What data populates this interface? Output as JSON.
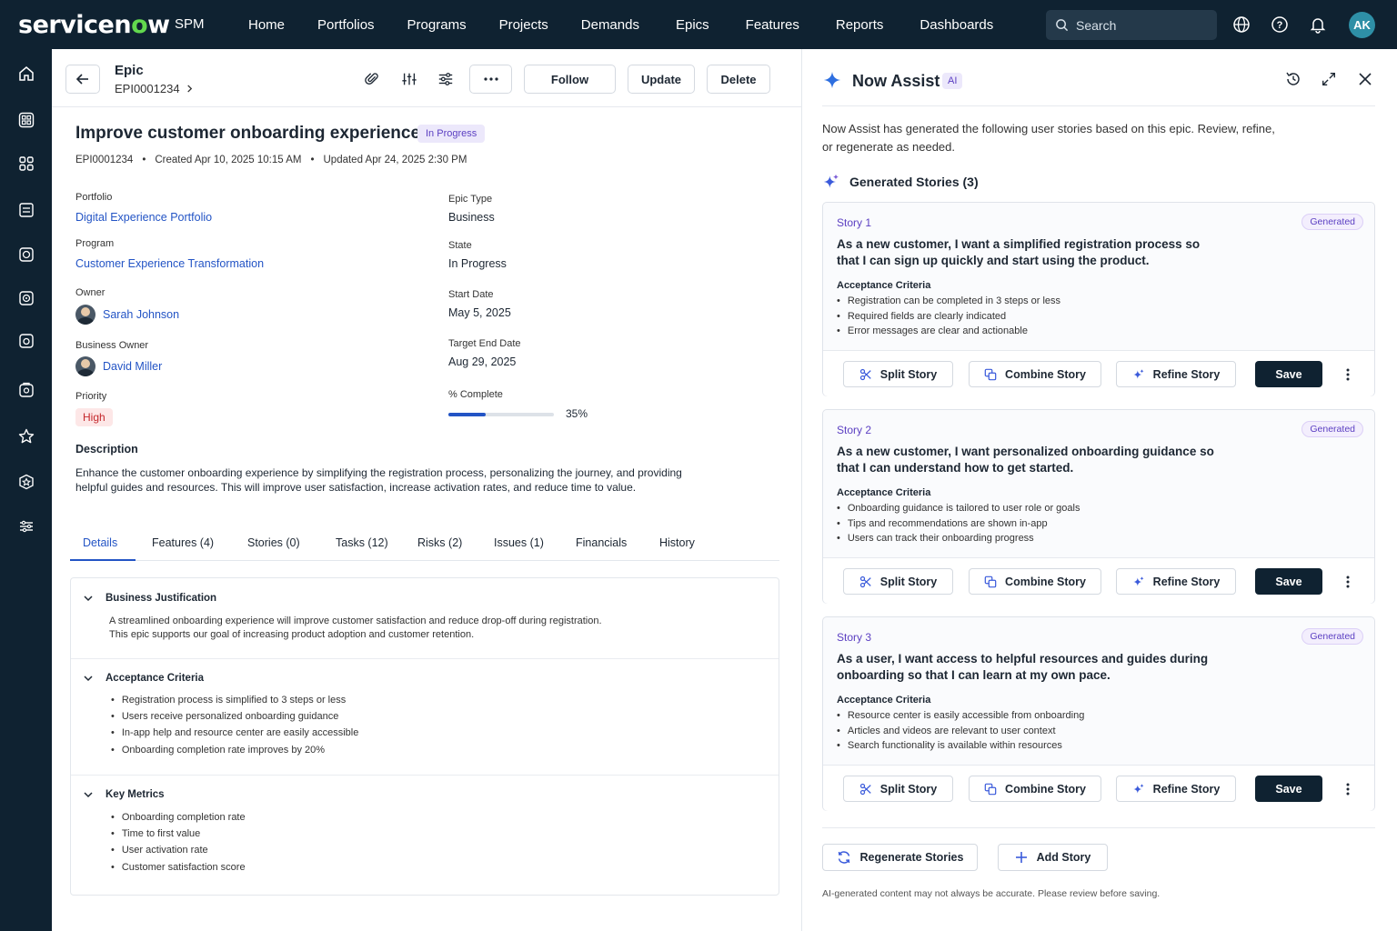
{
  "app": {
    "logo": "servicenow",
    "module": "SPM",
    "nav": [
      "Home",
      "Portfolios",
      "Programs",
      "Projects",
      "Demands",
      "Epics",
      "Features",
      "Reports",
      "Dashboards"
    ],
    "search_placeholder": "Search",
    "user_initials": "AK",
    "colors": {
      "nav_bg": "#0f2231",
      "accent": "#2354c5",
      "ai_purple": "#5b3fc2",
      "logo_o": "#62d84e"
    }
  },
  "record": {
    "type": "Epic",
    "number": "EPI0001234",
    "buttons": {
      "follow": "Follow",
      "update": "Update",
      "delete": "Delete"
    },
    "title": "Improve customer onboarding experience",
    "status": "In Progress",
    "meta": {
      "id": "EPI0001234",
      "created": "Created Apr 10, 2025 10:15 AM",
      "updated": "Updated Apr 24, 2025 2:30 PM"
    },
    "fields": {
      "portfolio_label": "Portfolio",
      "portfolio": "Digital Experience Portfolio",
      "program_label": "Program",
      "program": "Customer Experience Transformation",
      "owner_label": "Owner",
      "owner": "Sarah Johnson",
      "business_owner_label": "Business Owner",
      "business_owner": "David Miller",
      "priority_label": "Priority",
      "priority": "High",
      "epic_type_label": "Epic Type",
      "epic_type": "Business",
      "state_label": "State",
      "state": "In Progress",
      "start_label": "Start Date",
      "start": "May 5, 2025",
      "end_label": "Target End Date",
      "end": "Aug 29, 2025",
      "complete_label": "% Complete",
      "complete_text": "35%",
      "complete_value": 0.35
    },
    "description_label": "Description",
    "description": "Enhance the customer onboarding experience by simplifying the registration process, personalizing the journey, and providing helpful guides and resources. This will improve user satisfaction, increase activation rates, and reduce time to value.",
    "tabs": [
      "Details",
      "Features (4)",
      "Stories (0)",
      "Tasks (12)",
      "Risks (2)",
      "Issues (1)",
      "Financials",
      "History"
    ],
    "sections": {
      "justification": {
        "title": "Business Justification",
        "text": "A streamlined onboarding experience will improve customer satisfaction and reduce drop-off during registration. This epic supports our goal of increasing product adoption and customer retention."
      },
      "acceptance": {
        "title": "Acceptance Criteria",
        "items": [
          "Registration process is simplified to 3 steps or less",
          "Users receive personalized onboarding guidance",
          "In-app help and resource center are easily accessible",
          "Onboarding completion rate improves by 20%"
        ]
      },
      "metrics": {
        "title": "Key Metrics",
        "items": [
          "Onboarding completion rate",
          "Time to first value",
          "User activation rate",
          "Customer satisfaction score"
        ]
      }
    }
  },
  "assist": {
    "title": "Now Assist",
    "badge": "AI",
    "intro": "Now Assist has generated the following user stories based on this epic. Review, refine, or regenerate as needed.",
    "generated_heading": "Generated Stories (3)",
    "ac_label": "Acceptance Criteria",
    "generated_badge": "Generated",
    "actions": {
      "split": "Split Story",
      "combine": "Combine Story",
      "refine": "Refine Story",
      "save": "Save"
    },
    "stories": [
      {
        "label": "Story 1",
        "text": "As a new customer, I want a simplified registration process so that I can sign up quickly and start using the product.",
        "criteria": [
          "Registration can be completed in 3 steps or less",
          "Required fields are clearly indicated",
          "Error messages are clear and actionable"
        ]
      },
      {
        "label": "Story 2",
        "text": "As a new customer, I want personalized onboarding guidance so that I can understand how to get started.",
        "criteria": [
          "Onboarding guidance is tailored to user role or goals",
          "Tips and recommendations are shown in-app",
          "Users can track their onboarding progress"
        ]
      },
      {
        "label": "Story 3",
        "text": "As a user, I want access to helpful resources and guides during onboarding so that I can learn at my own pace.",
        "criteria": [
          "Resource center is easily accessible from onboarding",
          "Articles and videos are relevant to user context",
          "Search functionality is available within resources"
        ]
      }
    ],
    "regenerate": "Regenerate Stories",
    "add_story": "Add Story",
    "disclaimer": "AI-generated content may not always be accurate. Please review before saving."
  }
}
